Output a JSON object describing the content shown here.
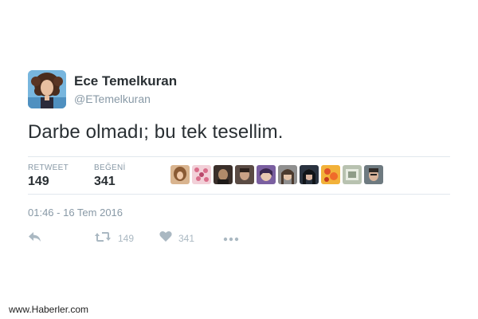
{
  "tweet": {
    "author_name": "Ece Temelkuran",
    "author_handle": "@ETemelkuran",
    "text": "Darbe olmadı; bu tek tesellim.",
    "stats": {
      "retweet_label": "RETWEET",
      "retweet_count": "149",
      "likes_label": "BEĞENİ",
      "likes_count": "341"
    },
    "timestamp": "01:46 - 16 Tem 2016",
    "actions": {
      "reply_icon": "reply-icon",
      "retweet_icon": "retweet-icon",
      "retweet_count": "149",
      "like_icon": "heart-icon",
      "like_count": "341",
      "more_icon": "more-dots-icon"
    }
  },
  "watermark": "www.Haberler.com",
  "colors": {
    "text_primary": "#292f33",
    "text_secondary": "#8899a6",
    "icon_gray": "#aab8c2",
    "divider": "#e1e8ed"
  }
}
